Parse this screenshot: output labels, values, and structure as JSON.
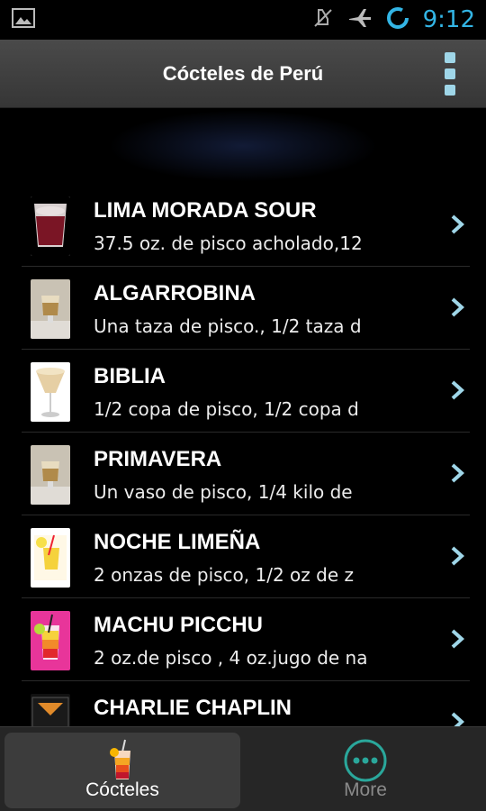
{
  "status_bar": {
    "time": "9:12",
    "icons": [
      "image-notification-icon",
      "mute-icon",
      "airplane-mode-icon",
      "sync-icon"
    ]
  },
  "action_bar": {
    "title": "Cócteles de Perú",
    "overflow_icon": "overflow-menu-icon"
  },
  "cocktails": [
    {
      "title": "LIMA MORADA SOUR",
      "subtitle": "37.5 oz. de pisco acholado,12",
      "thumb": "purple-drink"
    },
    {
      "title": "ALGARROBINA",
      "subtitle": " Una taza de pisco., 1/2 taza d",
      "thumb": "brown-drink"
    },
    {
      "title": "BIBLIA",
      "subtitle": " 1/2 copa de pisco, 1/2 copa d",
      "thumb": "cream-glass"
    },
    {
      "title": "PRIMAVERA",
      "subtitle": " Un vaso de pisco, 1/4 kilo de",
      "thumb": "brown-drink"
    },
    {
      "title": "NOCHE LIMEÑA",
      "subtitle": " 2 onzas de pisco, 1/2 oz de z",
      "thumb": "yellow-drink"
    },
    {
      "title": "MACHU PICCHU",
      "subtitle": " 2 oz.de pisco , 4 oz.jugo de na",
      "thumb": "layered-drink"
    },
    {
      "title": "CHARLIE CHAPLIN",
      "subtitle": "",
      "thumb": "martini"
    }
  ],
  "tabs": [
    {
      "label": "Cócteles",
      "icon": "cocktail-icon",
      "selected": true
    },
    {
      "label": "More",
      "icon": "more-icon",
      "selected": false
    }
  ],
  "colors": {
    "accent": "#33b5e5",
    "background": "#000000",
    "tab_bar": "#262626"
  }
}
